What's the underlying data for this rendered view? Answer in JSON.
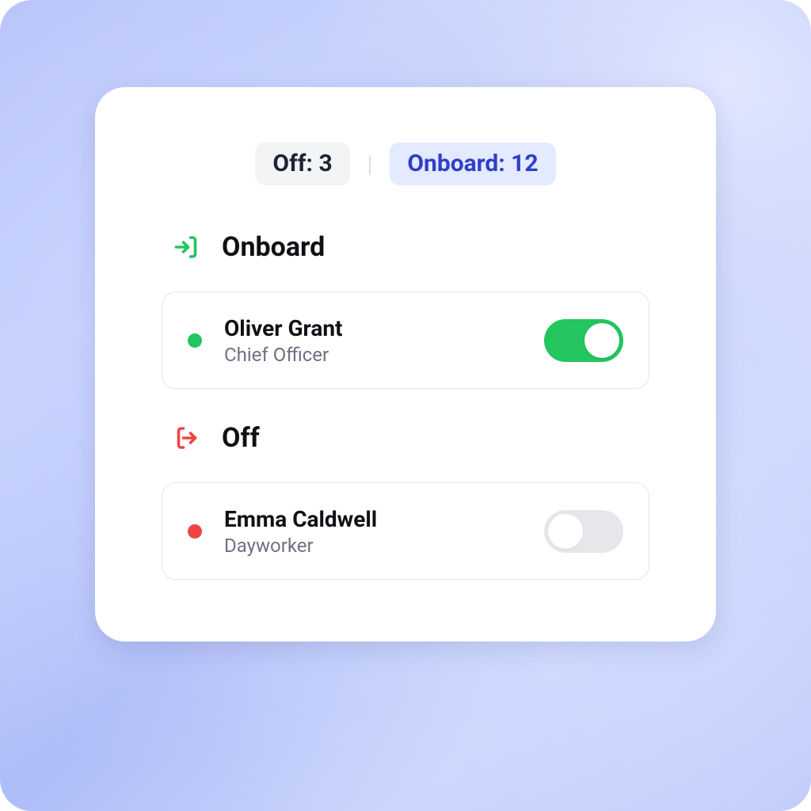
{
  "tabs": {
    "off": {
      "label": "Off: 3"
    },
    "onboard": {
      "label": "Onboard: 12"
    }
  },
  "sections": {
    "onboard": {
      "title": "Onboard"
    },
    "off": {
      "title": "Off"
    }
  },
  "people": {
    "onboard": [
      {
        "name": "Oliver Grant",
        "role": "Chief Officer",
        "status": "on"
      }
    ],
    "off": [
      {
        "name": "Emma Caldwell",
        "role": "Dayworker",
        "status": "off"
      }
    ]
  },
  "colors": {
    "green": "#22c55e",
    "red": "#ef4444",
    "accent": "#2f3fca"
  }
}
